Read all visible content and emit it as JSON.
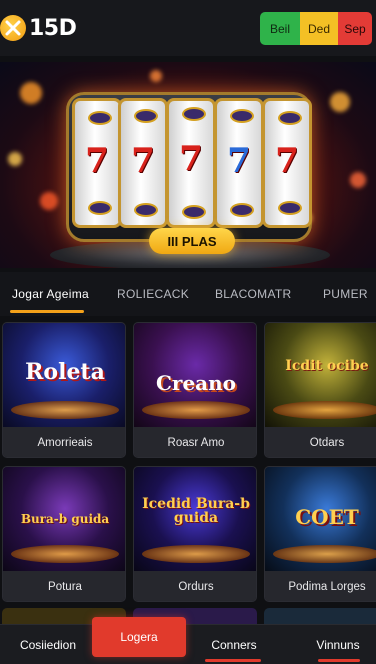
{
  "header": {
    "logo_text": "15D",
    "buttons": [
      {
        "label": "Beil",
        "color": "#2fb34a"
      },
      {
        "label": "Ded",
        "color": "#f4c025"
      },
      {
        "label": "Sep",
        "color": "#e33b36"
      }
    ]
  },
  "hero": {
    "play_label": "III PLAS",
    "accent": "#f4c025"
  },
  "tabs": [
    {
      "label": "Jogar Ageima",
      "active": true
    },
    {
      "label": "ROLIECACK",
      "active": false
    },
    {
      "label": "BLACOMATR",
      "active": false
    },
    {
      "label": "PUMER",
      "active": false
    }
  ],
  "cards": [
    {
      "art_title": "Roleta",
      "label": "Amorrieais"
    },
    {
      "art_title": "Creano",
      "label": "Roasr Amo"
    },
    {
      "art_title": "Icdit ocibe",
      "label": "Otdars"
    },
    {
      "art_title": "Bura-b guida",
      "label": "Potura"
    },
    {
      "art_title": "Icedid Bura-b guida",
      "label": "Ordurs"
    },
    {
      "art_title": "COET",
      "label": "Podima Lorges"
    }
  ],
  "bottom_nav": {
    "items": [
      "Cosiiedion",
      "Logera",
      "Conners",
      "Vinnuns"
    ],
    "active_color": "#e13a2c"
  }
}
